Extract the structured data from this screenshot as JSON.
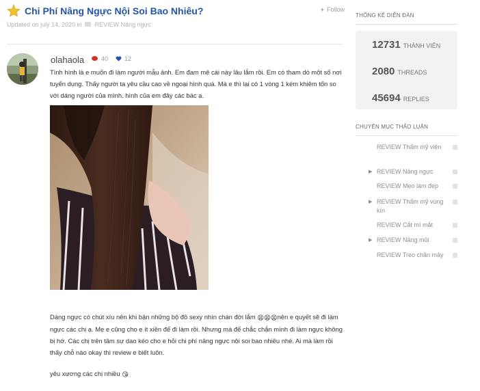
{
  "thread": {
    "title": "Chi Phí Nâng Ngực Nội Soi Bao Nhiêu?",
    "follow_label": "Follow",
    "updated_text": "Updated on july 14, 2020 in",
    "category": "REVIEW Nâng ngực"
  },
  "post": {
    "author": "olahaola",
    "comments": "40",
    "likes": "12",
    "paragraph1": "Tình hình là e muốn đi làm người mẫu ảnh. Em đam mê cái này lâu lắm rồi. Em có tham dò một số nơi tuyển dụng. Thấy người ta yêu cầu cao về ngoại hình quá. Mà e thì lại có 1 vòng 1 kém khiêm tốn so với dáng người của mình. hình của em đây các bác ạ.",
    "paragraph2_before": "Dáng ngực có chút xíu nên khi bận những bộ đồ sexy nhìn chán đời lắm ",
    "paragraph2_emoji": "😫😫😫",
    "paragraph2_after": "nên e quyết sẽ đi làm ngực các chị ạ. Mẹ e cũng cho e ít xiền để đi làm rồi. Nhưng mà để chắc chắn mình đi làm ngực không bị hớ. Các chị trên tâm sự dao kéo cho e hỏi chi phí nâng ngực nội soi bao nhiêu nhé. Ai mà làm rồi thấy chỗ nào okay thì review e biết luôn.",
    "paragraph3": "yêu xương các chị nhiều ",
    "paragraph3_emoji": "😘"
  },
  "sidebar": {
    "stats_heading": "THỐNG KÊ DIỄN ĐÀN",
    "stats": [
      {
        "value": "12731",
        "label": "THÀNH VIÊN"
      },
      {
        "value": "2080",
        "label": "THREADS"
      },
      {
        "value": "45694",
        "label": "REPLIES"
      }
    ],
    "categories_heading": "CHUYÊN MỤC THẢO LUẬN",
    "categories": [
      {
        "label": "REVIEW Thẩm mỹ viện"
      },
      {
        "label": "REVIEW Nâng ngực"
      },
      {
        "label": "REVIEW Mẹo làm đẹp"
      },
      {
        "label": "REVIEW Thẩm mỹ vùng kín"
      },
      {
        "label": "REVIEW Cắt mí mắt"
      },
      {
        "label": "REVIEW Nâng mũi"
      },
      {
        "label": "REVIEW Treo chân mày"
      }
    ],
    "bullet_glyph": "▶"
  },
  "colors": {
    "title": "#2553a8",
    "star": "#f2c12e",
    "comment_icon": "#d0342c",
    "heart_icon": "#2553a8"
  },
  "icons": [
    "star-icon",
    "plus-icon",
    "folder-icon",
    "comment-icon",
    "heart-icon",
    "bullet-arrow-icon"
  ]
}
